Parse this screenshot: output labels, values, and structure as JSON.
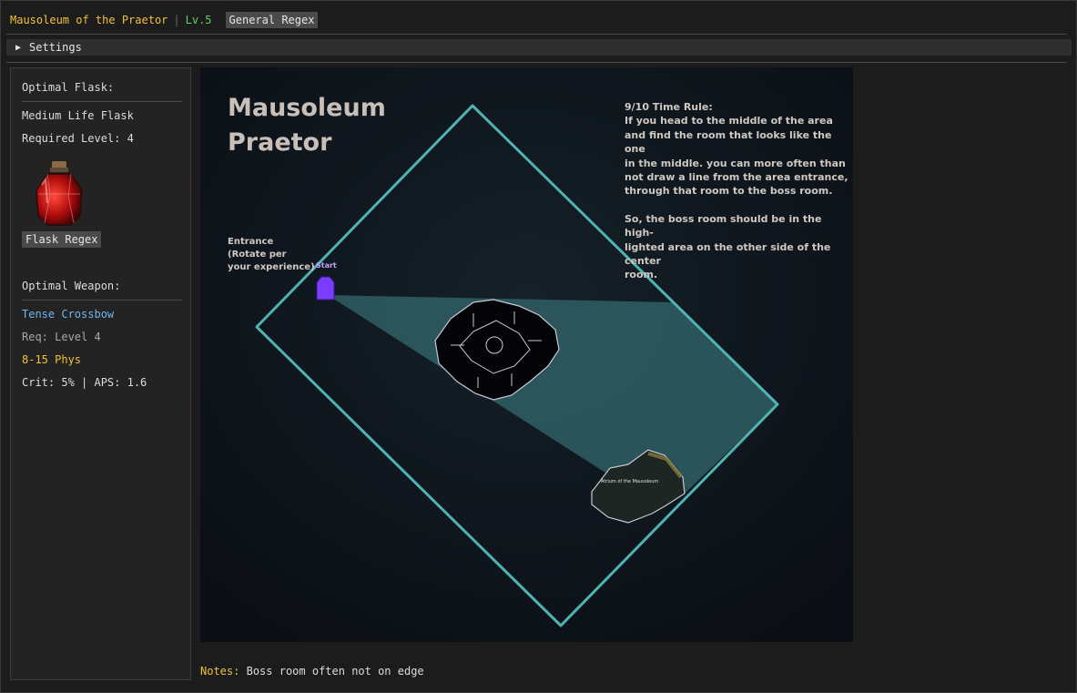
{
  "header": {
    "zone_name": "Mausoleum of the Praetor",
    "separator": "|",
    "level": "Lv.5",
    "regex_button": "General Regex"
  },
  "settings": {
    "label": "Settings"
  },
  "sidebar": {
    "flask_heading": "Optimal Flask:",
    "flask_name": "Medium Life Flask",
    "flask_required": "Required Level: 4",
    "flask_regex_button": "Flask Regex",
    "weapon_heading": "Optimal Weapon:",
    "weapon_name": "Tense Crossbow",
    "weapon_req": "Req: Level 4",
    "weapon_damage": "8-15 Phys",
    "weapon_stats": "Crit: 5% | APS: 1.6"
  },
  "map": {
    "title_line1": "Mausoleum",
    "title_line2": "Praetor",
    "rule_lines": [
      "9/10 Time Rule:",
      "If you head to the middle of the area",
      "and find the room that looks like the one",
      "in the middle. you can more often than",
      "not draw a line from the area entrance,",
      "through that room to the boss room.",
      "",
      "So, the boss room should be in the high-",
      "lighted area on the other side of the center",
      "room."
    ],
    "entrance_lines": [
      "Entrance",
      "(Rotate per",
      "your experience)"
    ],
    "start_label": "Start",
    "boss_room_label": "Atrium of the Mausoleum",
    "colors": {
      "outline": "#4fb3b3",
      "highlight": "#2f5f64",
      "start_marker": "#7b3cff"
    },
    "icons": [
      "flask-icon",
      "start-marker-icon",
      "center-room-icon",
      "boss-room-icon"
    ]
  },
  "notes": {
    "label": "Notes:",
    "text": "Boss room often not on edge"
  }
}
